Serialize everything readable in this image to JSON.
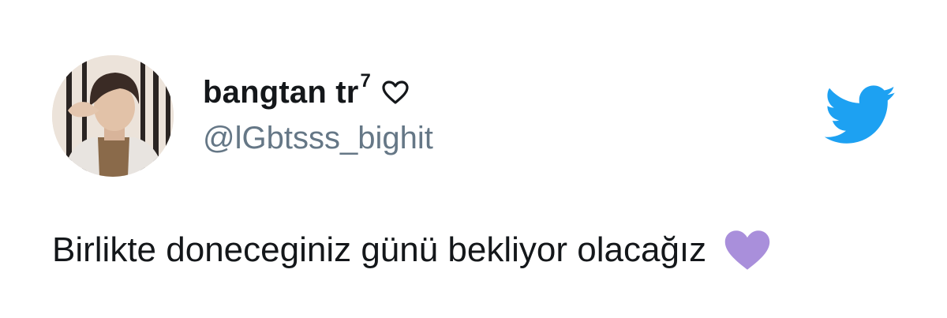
{
  "tweet": {
    "display_name": "bangtan tr",
    "name_superscript": "7",
    "name_icon": "outline-heart-icon",
    "handle": "@lGbtsss_bighit",
    "avatar_icon": "profile-photo",
    "platform_icon": "twitter-bird-icon",
    "text": "Birlikte doneceginiz günü bekliyor olacağız",
    "text_emoji": "purple-heart-icon"
  },
  "colors": {
    "text_primary": "#14171a",
    "text_secondary": "#657786",
    "twitter_blue": "#1da1f2",
    "purple_heart": "#a98fdb"
  }
}
